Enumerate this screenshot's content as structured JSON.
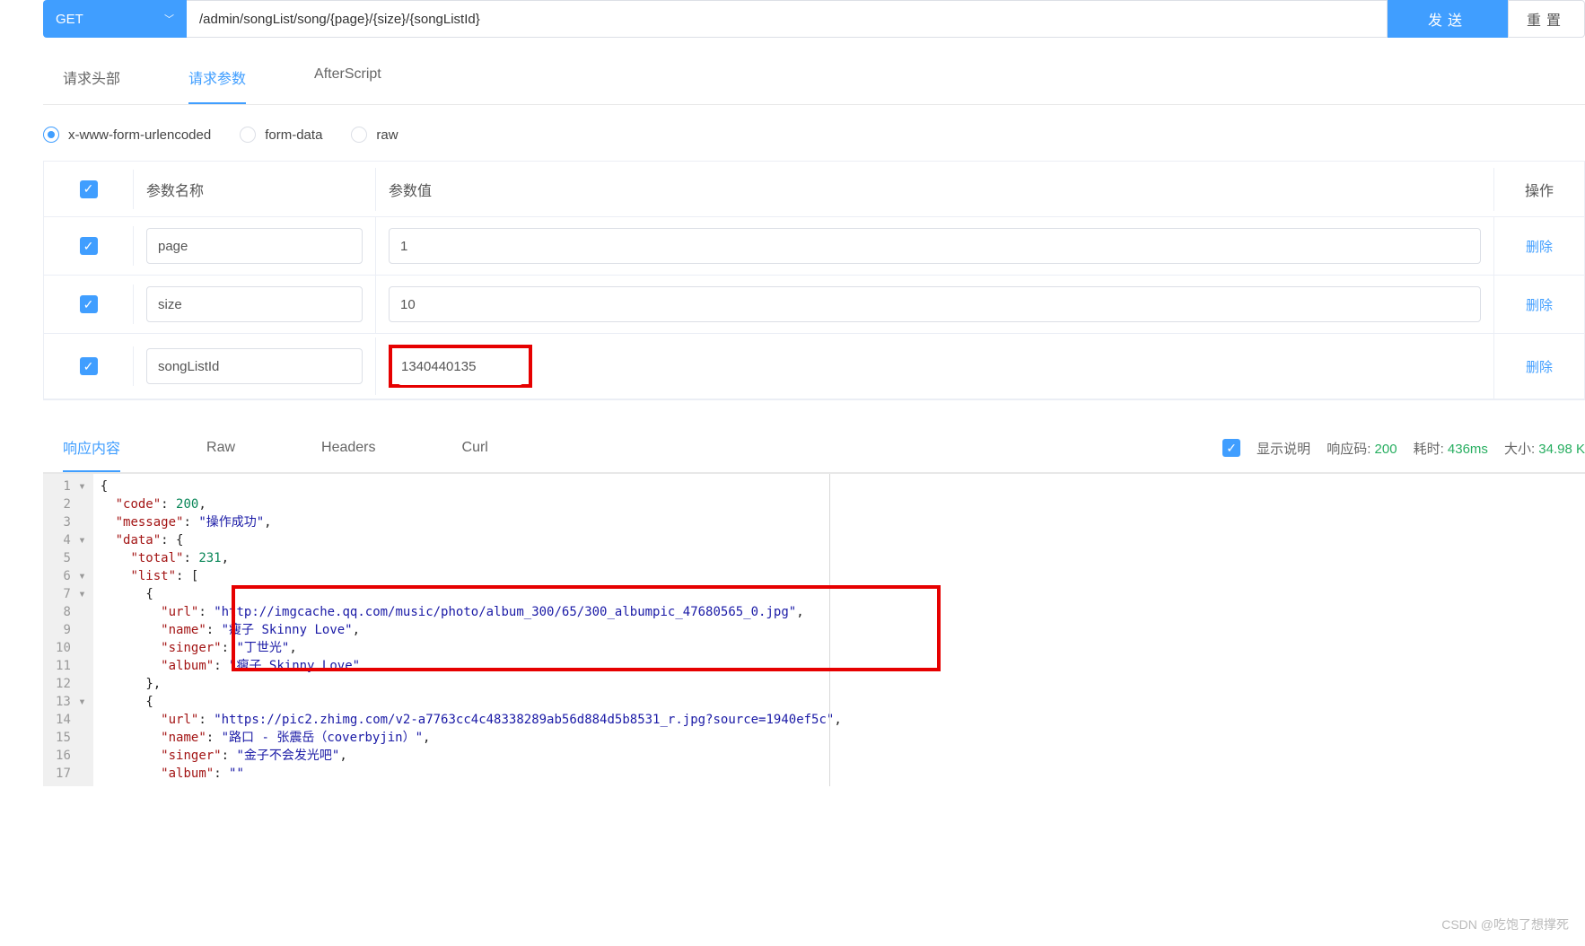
{
  "request": {
    "method": "GET",
    "url": "/admin/songList/song/{page}/{size}/{songListId}",
    "send_label": "发送",
    "reset_label": "重置"
  },
  "tabs": {
    "headers": "请求头部",
    "params": "请求参数",
    "afterscript": "AfterScript"
  },
  "body_types": {
    "xwww": "x-www-form-urlencoded",
    "formdata": "form-data",
    "raw": "raw"
  },
  "param_table": {
    "col_name": "参数名称",
    "col_value": "参数值",
    "col_ops": "操作",
    "delete_label": "删除",
    "rows": [
      {
        "name": "page",
        "value": "1"
      },
      {
        "name": "size",
        "value": "10"
      },
      {
        "name": "songListId",
        "value": "1340440135"
      }
    ]
  },
  "response_tabs": {
    "body": "响应内容",
    "raw": "Raw",
    "headers": "Headers",
    "curl": "Curl"
  },
  "response_status": {
    "show_desc": "显示说明",
    "code_label": "响应码:",
    "code": "200",
    "time_label": "耗时:",
    "time": "436ms",
    "size_label": "大小:",
    "size": "34.98 K"
  },
  "response_body": {
    "code": 200,
    "message": "操作成功",
    "data": {
      "total": 231,
      "list": [
        {
          "url": "http://imgcache.qq.com/music/photo/album_300/65/300_albumpic_47680565_0.jpg",
          "name": "瘦子 Skinny Love",
          "singer": "丁世光",
          "album": "瘦子 Skinny Love"
        },
        {
          "url": "https://pic2.zhimg.com/v2-a7763cc4c48338289ab56d884d5b8531_r.jpg?source=1940ef5c",
          "name": "路口 - 张震岳（coverbyjin）",
          "singer": "金子不会发光吧",
          "album": ""
        }
      ]
    }
  },
  "watermark": "CSDN @吃饱了想撑死"
}
